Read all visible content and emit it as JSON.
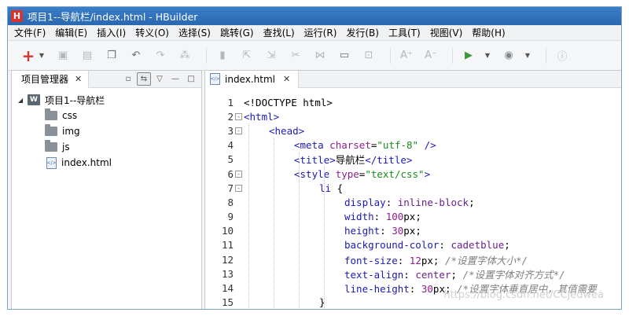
{
  "window": {
    "title": "项目1--导航栏/index.html - HBuilder",
    "logo": "H"
  },
  "menu": [
    "文件(F)",
    "编辑(E)",
    "插入(I)",
    "转义(O)",
    "选择(S)",
    "跳转(G)",
    "查找(L)",
    "运行(R)",
    "发行(B)",
    "工具(T)",
    "视图(V)",
    "帮助(H)"
  ],
  "toolbar": {
    "icons": [
      "new-icon",
      "save-icon",
      "save-all-icon",
      "clipboard-icon",
      "undo-icon",
      "redo-icon",
      "format-icon",
      "bookmark-icon",
      "export-icon",
      "import-icon",
      "cut-icon",
      "merge-icon",
      "comment-icon",
      "browser-icon",
      "font-increase-icon",
      "font-decrease-icon",
      "run-icon",
      "settings-icon",
      "info-icon"
    ]
  },
  "project_panel": {
    "tab_label": "项目管理器",
    "project": {
      "name": "项目1--导航栏",
      "icon": "W"
    },
    "items": [
      {
        "name": "css",
        "type": "folder"
      },
      {
        "name": "img",
        "type": "folder"
      },
      {
        "name": "js",
        "type": "folder"
      },
      {
        "name": "index.html",
        "type": "file"
      }
    ]
  },
  "editor": {
    "tab_label": "index.html",
    "lines": [
      {
        "n": "1",
        "fold": "",
        "indent": 0,
        "html": "<span class='plain'>&lt;!DOCTYPE html&gt;</span>"
      },
      {
        "n": "2",
        "fold": "-",
        "indent": 0,
        "html": "<span class='tag'>&lt;html&gt;</span>"
      },
      {
        "n": "3",
        "fold": "-",
        "indent": 1,
        "html": "<span class='tag'>&lt;head&gt;</span>"
      },
      {
        "n": "4",
        "fold": "",
        "indent": 2,
        "html": "<span class='tag'>&lt;meta</span> <span class='attr'>charset</span>=<span class='str'>\"utf-8\"</span> <span class='tag'>/&gt;</span>"
      },
      {
        "n": "5",
        "fold": "",
        "indent": 2,
        "html": "<span class='tag'>&lt;title&gt;</span><span class='plain'>导航栏</span><span class='tag'>&lt;/title&gt;</span>"
      },
      {
        "n": "6",
        "fold": "-",
        "indent": 2,
        "html": "<span class='tag'>&lt;style</span> <span class='attr'>type</span>=<span class='str'>\"text/css\"</span><span class='tag'>&gt;</span>"
      },
      {
        "n": "7",
        "fold": "-",
        "indent": 3,
        "html": "<span class='tag'>li</span> <span class='plain'>{</span>"
      },
      {
        "n": "8",
        "fold": "",
        "indent": 4,
        "html": "<span class='prop'>display</span><span class='plain'>: </span><span class='val'>inline-block</span><span class='plain'>;</span>"
      },
      {
        "n": "9",
        "fold": "",
        "indent": 4,
        "html": "<span class='prop'>width</span><span class='plain'>: </span><span class='num'>100</span><span class='plain'>px;</span>"
      },
      {
        "n": "10",
        "fold": "",
        "indent": 4,
        "html": "<span class='prop'>height</span><span class='plain'>: </span><span class='num'>30</span><span class='plain'>px;</span>"
      },
      {
        "n": "11",
        "fold": "",
        "indent": 4,
        "html": "<span class='prop'>background-color</span><span class='plain'>: </span><span class='val'>cadetblue</span><span class='plain'>;</span>"
      },
      {
        "n": "12",
        "fold": "",
        "indent": 4,
        "html": "<span class='prop'>font-size</span><span class='plain'>: </span><span class='num'>12</span><span class='plain'>px; </span><span class='cmt'>/*设置字体大小*/</span>"
      },
      {
        "n": "13",
        "fold": "",
        "indent": 4,
        "html": "<span class='prop'>text-align</span><span class='plain'>: </span><span class='val'>center</span><span class='plain'>; </span><span class='cmt'>/*设置字体对齐方式*/</span>"
      },
      {
        "n": "14",
        "fold": "",
        "indent": 4,
        "html": "<span class='prop'>line-height</span><span class='plain'>: </span><span class='num'>30</span><span class='plain'>px; </span><span class='cmt'>/*设置字体垂直居中，其值需要</span>"
      },
      {
        "n": "15",
        "fold": "",
        "indent": 3,
        "html": "<span class='plain'>}</span>"
      }
    ]
  },
  "watermark": "https://blog.csdn.net/CCjedwea"
}
